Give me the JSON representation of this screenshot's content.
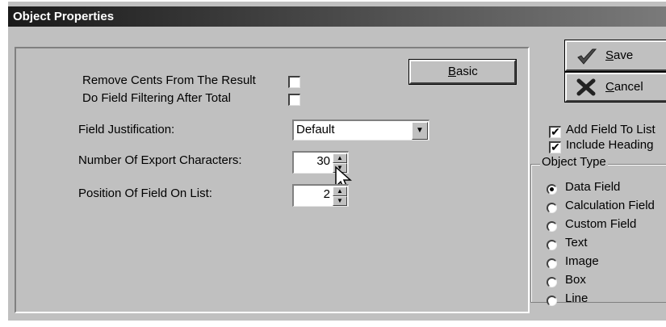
{
  "window": {
    "title": "Object Properties"
  },
  "panel": {
    "remove_cents_label": "Remove Cents From The Result",
    "remove_cents_checked": false,
    "field_filtering_label": "Do Field Filtering After Total",
    "field_filtering_checked": false,
    "basic_button": {
      "hotkey": "B",
      "rest": "asic"
    },
    "justification_label": "Field Justification:",
    "justification_value": "Default",
    "export_chars_label": "Number Of Export Characters:",
    "export_chars_value": "30",
    "position_label": "Position Of Field On List:",
    "position_value": "2"
  },
  "buttons": {
    "save": {
      "hotkey": "S",
      "rest": "ave"
    },
    "cancel": {
      "hotkey": "C",
      "rest": "ancel"
    }
  },
  "options": {
    "add_field_label": "Add Field To List",
    "add_field_checked": true,
    "include_heading_label": "Include Heading",
    "include_heading_checked": true
  },
  "object_type": {
    "title": "Object Type",
    "selected": "Data Field",
    "items": [
      "Data Field",
      "Calculation Field",
      "Custom Field",
      "Text",
      "Image",
      "Box",
      "Line"
    ]
  },
  "colors": {
    "title_gradient_start": "#1a1a1a",
    "face": "#c0c0c0",
    "save_check": "#4a4a4a",
    "cancel_x": "#222222"
  }
}
